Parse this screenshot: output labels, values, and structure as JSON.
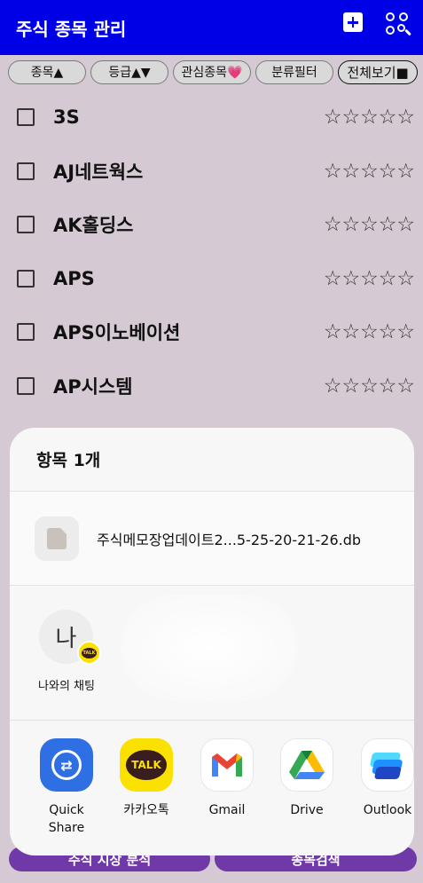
{
  "app": {
    "title": "주식 종목 관리"
  },
  "filters": [
    {
      "label": "종목▲"
    },
    {
      "label": "등급▲▼"
    },
    {
      "label": "관심종목💗"
    },
    {
      "label": "분류필터"
    },
    {
      "label": "전체보기■"
    }
  ],
  "stocks": [
    {
      "name": "3S",
      "stars": "☆☆☆☆☆"
    },
    {
      "name": "AJ네트웍스",
      "stars": "☆☆☆☆☆"
    },
    {
      "name": "AK홀딩스",
      "stars": "☆☆☆☆☆"
    },
    {
      "name": "APS",
      "stars": "☆☆☆☆☆"
    },
    {
      "name": "APS이노베이션",
      "stars": "☆☆☆☆☆"
    },
    {
      "name": "AP시스템",
      "stars": "☆☆☆☆☆"
    }
  ],
  "bottom_buttons": {
    "left": "주식 시장 분석",
    "right": "종목검색"
  },
  "share_sheet": {
    "title": "항목 1개",
    "file_name": "주식메모장업데이트2...5-25-20-21-26.db",
    "contact": {
      "avatar_text": "나",
      "label": "나와의 채팅",
      "badge": "TALK"
    },
    "apps": [
      {
        "name": "Quick\nShare",
        "line1": "Quick",
        "line2": "Share",
        "icon": "quick-share-icon"
      },
      {
        "name": "카카오톡",
        "line1": "카카오톡",
        "line2": "",
        "icon": "kakaotalk-icon",
        "badge": "TALK"
      },
      {
        "name": "Gmail",
        "line1": "Gmail",
        "line2": "",
        "icon": "gmail-icon"
      },
      {
        "name": "Drive",
        "line1": "Drive",
        "line2": "",
        "icon": "drive-icon"
      },
      {
        "name": "Outlook",
        "line1": "Outlook",
        "line2": "",
        "icon": "outlook-icon"
      }
    ]
  },
  "colors": {
    "titlebar": "#0000e6",
    "list_bg": "#d5cad3",
    "button_purple": "#6f3aa8",
    "kakao_yellow": "#fae100"
  }
}
